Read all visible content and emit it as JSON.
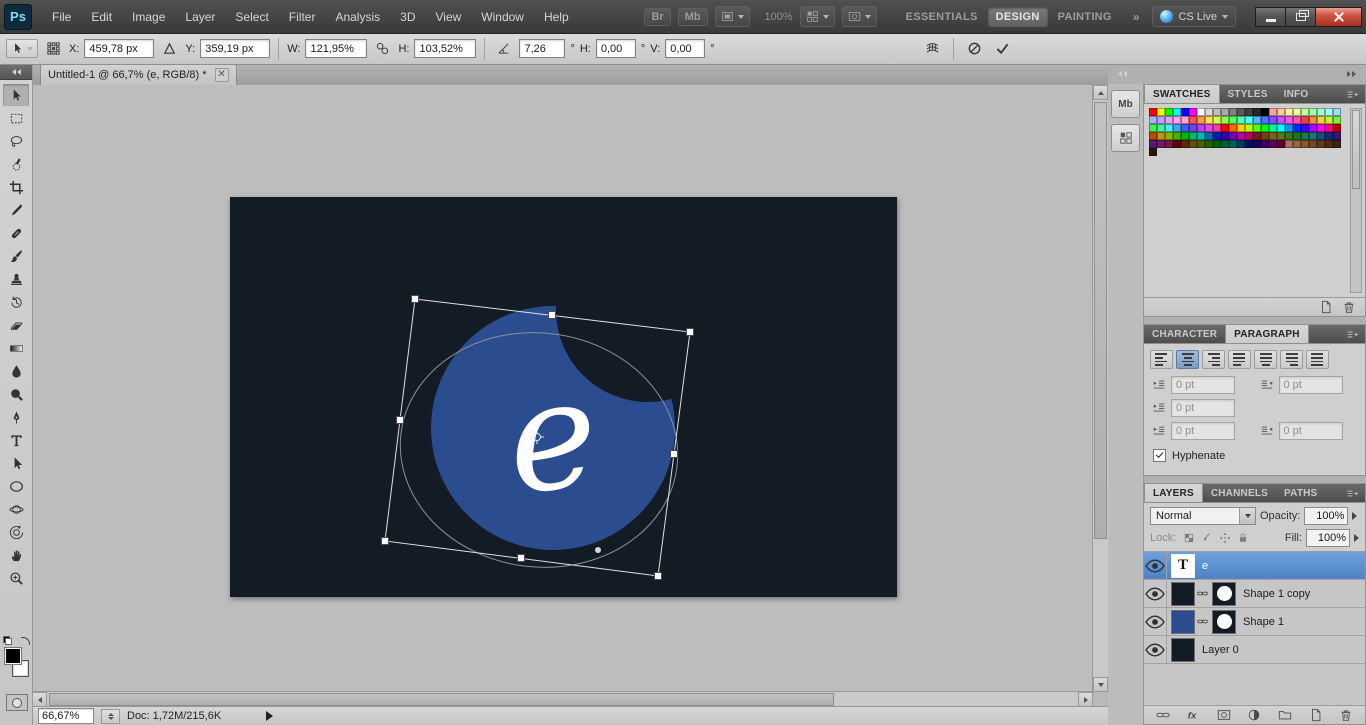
{
  "menu_bar": {
    "logo": "Ps",
    "menus": [
      "File",
      "Edit",
      "Image",
      "Layer",
      "Select",
      "Filter",
      "Analysis",
      "3D",
      "View",
      "Window",
      "Help"
    ],
    "bridge_label": "Br",
    "mini_bridge_label": "Mb",
    "zoom_display": "100%",
    "workspaces": [
      "ESSENTIALS",
      "DESIGN",
      "PAINTING"
    ],
    "active_workspace": "DESIGN",
    "overflow_chevrons": "»",
    "cs_live_label": "CS Live"
  },
  "options_bar": {
    "x_label": "X:",
    "x_value": "459,78 px",
    "y_label": "Y:",
    "y_value": "359,19 px",
    "w_label": "W:",
    "w_value": "121,95%",
    "h_label": "H:",
    "h_value": "103,52%",
    "angle_value": "7,26",
    "h_skew_label": "H:",
    "h_skew_value": "0,00",
    "v_skew_label": "V:",
    "v_skew_value": "0,00",
    "degree": "°"
  },
  "document_tab": {
    "title": "Untitled-1 @ 66,7% (e, RGB/8) *",
    "close": "✕"
  },
  "canvas": {
    "letter": "e",
    "doc_bg": "#131b24",
    "shape_color": "#2b4c8e"
  },
  "dock": {
    "mini_bridge_icon_label": "Mb"
  },
  "tools": [
    {
      "name": "move-icon",
      "sym": "move"
    },
    {
      "name": "marquee-icon",
      "sym": "marquee"
    },
    {
      "name": "lasso-icon",
      "sym": "lasso"
    },
    {
      "name": "quick-selection-icon",
      "sym": "quickselect"
    },
    {
      "name": "crop-icon",
      "sym": "crop"
    },
    {
      "name": "eyedropper-icon",
      "sym": "eyedropper"
    },
    {
      "name": "healing-brush-icon",
      "sym": "healing"
    },
    {
      "name": "brush-icon",
      "sym": "brush"
    },
    {
      "name": "clone-stamp-icon",
      "sym": "stamp"
    },
    {
      "name": "history-brush-icon",
      "sym": "history"
    },
    {
      "name": "eraser-icon",
      "sym": "eraser"
    },
    {
      "name": "gradient-icon",
      "sym": "gradient"
    },
    {
      "name": "blur-icon",
      "sym": "blur"
    },
    {
      "name": "dodge-icon",
      "sym": "dodge"
    },
    {
      "name": "pen-icon",
      "sym": "pen"
    },
    {
      "name": "type-icon",
      "sym": "type"
    },
    {
      "name": "path-selection-icon",
      "sym": "pathselect"
    },
    {
      "name": "ellipse-icon",
      "sym": "ellipse"
    },
    {
      "name": "rotate-3d-icon",
      "sym": "rotate3d"
    },
    {
      "name": "camera-3d-icon",
      "sym": "camera3d"
    },
    {
      "name": "hand-icon",
      "sym": "hand"
    },
    {
      "name": "zoom-icon",
      "sym": "zoom"
    }
  ],
  "swatches_panel": {
    "tabs": [
      "SWATCHES",
      "STYLES",
      "INFO"
    ],
    "active_tab": "SWATCHES",
    "colors": [
      "#ff0000",
      "#ffff00",
      "#00ff00",
      "#00ffff",
      "#0000ff",
      "#ff00ff",
      "#ffffff",
      "#d9d9d9",
      "#bfbfbf",
      "#a6a6a6",
      "#808080",
      "#595959",
      "#404040",
      "#262626",
      "#000000",
      "hsl(0,100%,82%)",
      "hsl(25,100%,82%)",
      "hsl(50,100%,82%)",
      "hsl(75,100%,82%)",
      "hsl(100,100%,82%)",
      "hsl(125,100%,82%)",
      "hsl(155,100%,82%)",
      "hsl(180,100%,82%)",
      "hsl(205,100%,82%)",
      "hsl(230,100%,82%)",
      "hsl(255,100%,82%)",
      "hsl(280,100%,82%)",
      "hsl(305,100%,82%)",
      "hsl(330,100%,82%)",
      "hsl(0,100%,66%)",
      "hsl(25,100%,66%)",
      "hsl(50,100%,66%)",
      "hsl(75,100%,66%)",
      "hsl(100,100%,66%)",
      "hsl(125,100%,66%)",
      "hsl(155,100%,66%)",
      "hsl(180,100%,66%)",
      "hsl(205,100%,66%)",
      "hsl(230,100%,66%)",
      "hsl(255,100%,66%)",
      "hsl(280,100%,66%)",
      "hsl(305,100%,66%)",
      "hsl(330,100%,66%)",
      "hsl(0,85%,60%)",
      "hsl(25,85%,60%)",
      "hsl(50,85%,60%)",
      "hsl(75,85%,60%)",
      "hsl(100,85%,60%)",
      "hsl(125,85%,60%)",
      "hsl(155,85%,60%)",
      "hsl(180,85%,60%)",
      "hsl(205,85%,60%)",
      "hsl(230,85%,60%)",
      "hsl(255,85%,60%)",
      "hsl(280,85%,60%)",
      "hsl(305,85%,60%)",
      "hsl(330,85%,60%)",
      "hsl(0,100%,50%)",
      "hsl(25,100%,50%)",
      "hsl(50,100%,50%)",
      "hsl(75,100%,50%)",
      "hsl(100,100%,50%)",
      "hsl(125,100%,50%)",
      "hsl(155,100%,50%)",
      "hsl(180,100%,50%)",
      "hsl(205,100%,50%)",
      "hsl(230,100%,50%)",
      "hsl(255,100%,50%)",
      "hsl(280,100%,50%)",
      "hsl(305,100%,50%)",
      "hsl(330,100%,50%)",
      "hsl(0,100%,36%)",
      "hsl(25,100%,36%)",
      "hsl(50,100%,36%)",
      "hsl(75,100%,36%)",
      "hsl(100,100%,36%)",
      "hsl(125,100%,36%)",
      "hsl(155,100%,36%)",
      "hsl(180,100%,36%)",
      "hsl(205,100%,36%)",
      "hsl(230,100%,36%)",
      "hsl(255,100%,36%)",
      "hsl(280,100%,36%)",
      "hsl(305,100%,36%)",
      "hsl(330,100%,36%)",
      "hsl(0,65%,28%)",
      "hsl(25,65%,28%)",
      "hsl(50,65%,28%)",
      "hsl(75,65%,28%)",
      "hsl(100,65%,28%)",
      "hsl(125,65%,28%)",
      "hsl(155,65%,28%)",
      "hsl(180,65%,28%)",
      "hsl(205,65%,28%)",
      "hsl(230,65%,28%)",
      "hsl(255,65%,28%)",
      "hsl(280,65%,28%)",
      "hsl(305,65%,28%)",
      "hsl(330,65%,28%)",
      "hsl(0,100%,19%)",
      "hsl(25,100%,19%)",
      "hsl(50,100%,19%)",
      "hsl(75,100%,19%)",
      "hsl(100,100%,19%)",
      "hsl(125,100%,19%)",
      "hsl(155,100%,19%)",
      "hsl(180,100%,19%)",
      "hsl(205,100%,19%)",
      "hsl(230,100%,19%)",
      "hsl(255,100%,19%)",
      "hsl(280,100%,19%)",
      "hsl(305,100%,19%)",
      "hsl(330,100%,19%)",
      "#a6754f",
      "#96653f",
      "#855632",
      "#734727",
      "#61391d",
      "#4f2d15",
      "#3d220e",
      "#2b1708"
    ],
    "bottom_icons": [
      {
        "name": "new-swatch-icon",
        "sym": "newdoc"
      },
      {
        "name": "delete-swatch-icon",
        "sym": "trash"
      }
    ]
  },
  "paragraph_panel": {
    "tabs": [
      "CHARACTER",
      "PARAGRAPH"
    ],
    "active_tab": "PARAGRAPH",
    "alignment_buttons": [
      "align-left",
      "align-center",
      "align-right",
      "justify-last-left",
      "justify-last-center",
      "justify-last-right",
      "justify-all"
    ],
    "active_alignment_index": 1,
    "fields": [
      {
        "name": "indent-left-field",
        "value": "0 pt"
      },
      {
        "name": "indent-right-field",
        "value": "0 pt"
      },
      {
        "name": "first-line-indent-field",
        "value": "0 pt"
      },
      {
        "name": "space-before-field",
        "value": "0 pt"
      },
      {
        "name": "space-after-field",
        "value": "0 pt"
      }
    ],
    "hyphenate_label": "Hyphenate",
    "hyphenate_checked": true
  },
  "layers_panel": {
    "tabs": [
      "LAYERS",
      "CHANNELS",
      "PATHS"
    ],
    "active_tab": "LAYERS",
    "blend_mode": "Normal",
    "opacity_label": "Opacity:",
    "opacity_value": "100%",
    "lock_label": "Lock:",
    "fill_label": "Fill:",
    "fill_value": "100%",
    "lock_icons": [
      {
        "name": "lock-transparency-icon",
        "sym": "checker"
      },
      {
        "name": "lock-pixels-icon",
        "sym": "brushlock"
      },
      {
        "name": "lock-position-icon",
        "sym": "movelock"
      },
      {
        "name": "lock-all-icon",
        "sym": "lock"
      }
    ],
    "layers": [
      {
        "name": "e",
        "kind": "text",
        "selected": true
      },
      {
        "name": "Shape 1 copy",
        "kind": "shape",
        "thumb_color": "#131b24"
      },
      {
        "name": "Shape 1",
        "kind": "shape",
        "thumb_color": "#2b4c8e"
      },
      {
        "name": "Layer 0",
        "kind": "image",
        "thumb_color": "#131b24"
      }
    ],
    "bottom_icons": [
      {
        "name": "link-layers-icon",
        "sym": "link"
      },
      {
        "name": "layer-style-icon",
        "sym": "fx"
      },
      {
        "name": "add-layer-mask-icon",
        "sym": "mask"
      },
      {
        "name": "new-adjustment-layer-icon",
        "sym": "adjust"
      },
      {
        "name": "new-group-icon",
        "sym": "folder"
      },
      {
        "name": "new-layer-icon",
        "sym": "newdoc"
      },
      {
        "name": "delete-layer-icon",
        "sym": "trash"
      }
    ]
  },
  "status_bar": {
    "zoom": "66,67%",
    "doc_info": "Doc: 1,72M/215,6K"
  }
}
